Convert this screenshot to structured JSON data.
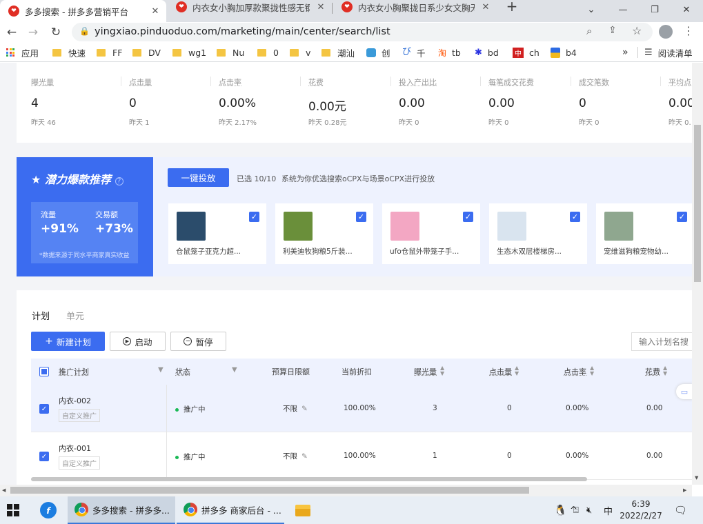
{
  "browser": {
    "tabs": [
      {
        "title": "多多搜索 - 拼多多营销平台",
        "active": true
      },
      {
        "title": "内衣女小胸加厚款聚拢性感无钢圈",
        "active": false
      },
      {
        "title": "内衣女小胸聚拢日系少女文胸无钢",
        "active": false
      }
    ],
    "url": "yingxiao.pinduoduo.com/marketing/main/center/search/list",
    "bookmarks": [
      "应用",
      "快速",
      "FF",
      "DV",
      "wg1",
      "Nu",
      "0",
      "v",
      "潮汕",
      "创",
      "千",
      "tb",
      "bd",
      "ch",
      "b4"
    ],
    "reading_list": "阅读清单"
  },
  "metrics": [
    {
      "label": "曝光量",
      "value": "4",
      "sub": "昨天 46"
    },
    {
      "label": "点击量",
      "value": "0",
      "sub": "昨天 1"
    },
    {
      "label": "点击率",
      "value": "0.00%",
      "sub": "昨天 2.17%"
    },
    {
      "label": "花费",
      "value": "0.00元",
      "sub": "昨天 0.28元"
    },
    {
      "label": "投入产出比",
      "value": "0.00",
      "sub": "昨天 0"
    },
    {
      "label": "每笔成交花费",
      "value": "0.00",
      "sub": "昨天 0"
    },
    {
      "label": "成交笔数",
      "value": "0",
      "sub": "昨天 0"
    },
    {
      "label": "平均点",
      "value": "0.00",
      "sub": "昨天 0."
    }
  ],
  "potential": {
    "title": "潜力爆款推荐",
    "flow_label": "流量",
    "flow_value": "+91%",
    "trade_label": "交易额",
    "trade_value": "+73%",
    "note": "*数据来源于同水平商家真实收益",
    "launch_button": "一键投放",
    "selected_label": "已选",
    "selected_count": "10/10",
    "desc": "系统为你优选搜索oCPX与场景oCPX进行投放",
    "products": [
      {
        "name": "仓鼠笼子亚克力超...",
        "color": "#2b4c6b"
      },
      {
        "name": "利美迪牧狗粮5斤装...",
        "color": "#6a8f3a"
      },
      {
        "name": "ufo仓鼠外带笼子手...",
        "color": "#f3a7c3"
      },
      {
        "name": "生态木双层楼梯房...",
        "color": "#d9e4ef"
      },
      {
        "name": "宠维滋狗粮宠物幼...",
        "color": "#8fa78f"
      }
    ]
  },
  "plans": {
    "tabs": [
      "计划",
      "单元"
    ],
    "new_button": "新建计划",
    "start_button": "启动",
    "pause_button": "暂停",
    "search_placeholder": "输入计划名搜",
    "columns": [
      "推广计划",
      "状态",
      "预算日限额",
      "当前折扣",
      "曝光量",
      "点击量",
      "点击率",
      "花费"
    ],
    "rows": [
      {
        "name": "内衣-002",
        "tag": "自定义推广",
        "status": "推广中",
        "budget": "不限",
        "discount": "100.00%",
        "impressions": "3",
        "clicks": "0",
        "ctr": "0.00%",
        "cost": "0.00"
      },
      {
        "name": "内衣-001",
        "tag": "自定义推广",
        "status": "推广中",
        "budget": "不限",
        "discount": "100.00%",
        "impressions": "1",
        "clicks": "0",
        "ctr": "0.00%",
        "cost": "0.00"
      }
    ]
  },
  "taskbar": {
    "items": [
      "多多搜索 - 拼多多...",
      "拼多多 商家后台 - ..."
    ],
    "ime": "中",
    "time": "6:39",
    "date": "2022/2/27"
  }
}
